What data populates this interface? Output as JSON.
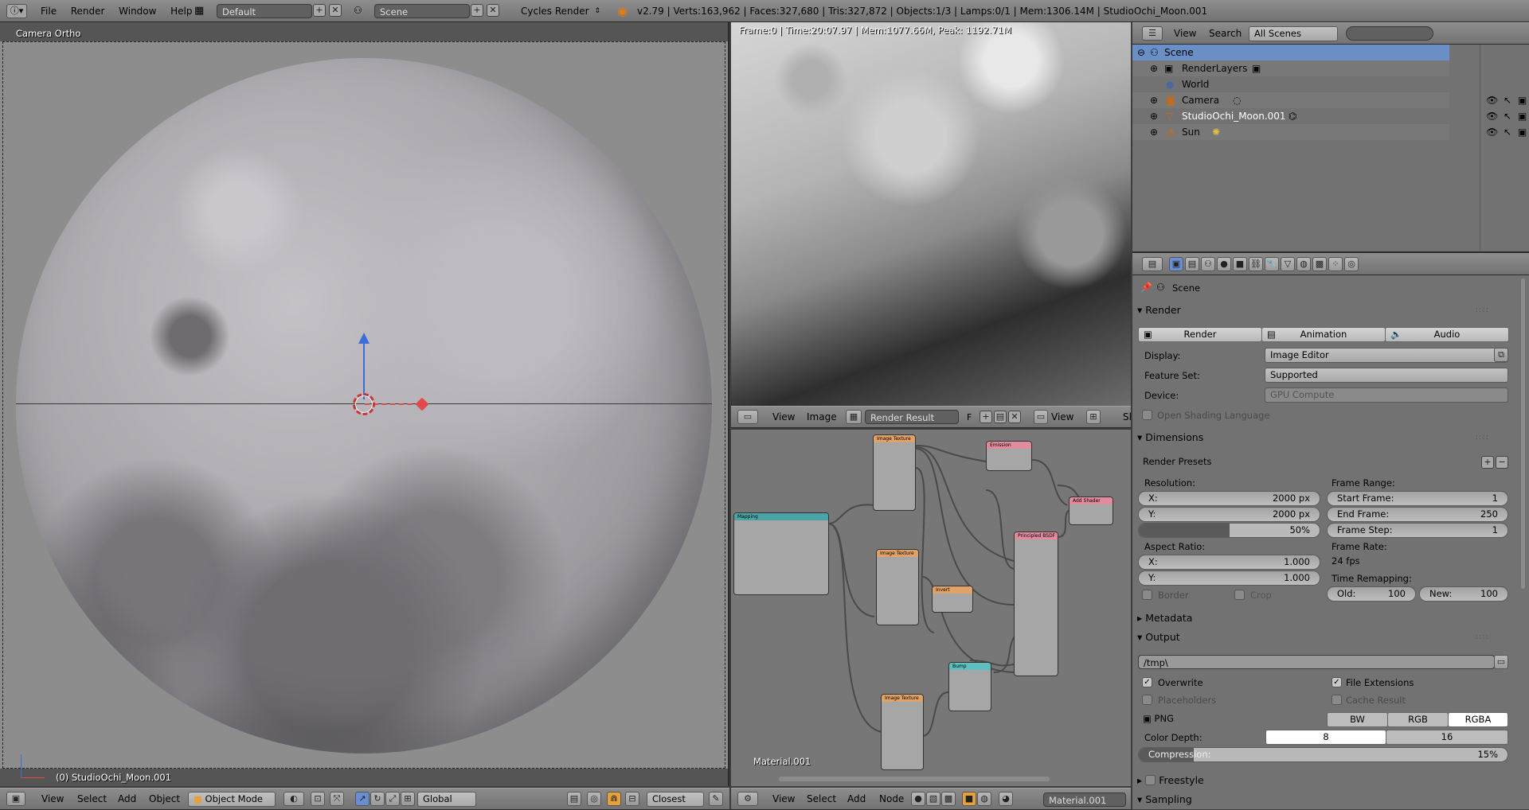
{
  "info_header": {
    "menus": [
      "File",
      "Render",
      "Window",
      "Help"
    ],
    "screen_layout": "Default",
    "scene_name": "Scene",
    "render_engine": "Cycles Render",
    "stats": "v2.79 | Verts:163,962 | Faces:327,680 | Tris:327,872 | Objects:1/3 | Lamps:0/1 | Mem:1306.14M | StudioOchi_Moon.001"
  },
  "viewport3d": {
    "view_name": "Camera Ortho",
    "object_label": "(0) StudioOchi_Moon.001",
    "header_menus": [
      "View",
      "Select",
      "Add",
      "Object"
    ],
    "mode": "Object Mode",
    "orientation": "Global",
    "snap_target": "Closest"
  },
  "render_view": {
    "info": "Frame:0 | Time:20:07.97 | Mem:1077.66M, Peak: 1192.71M",
    "header_menus": [
      "View",
      "Image"
    ],
    "image_name": "Render Result",
    "fake_user": "F",
    "view_menu": "View",
    "slot": "Sl"
  },
  "node_editor": {
    "material_label": "Material.001",
    "header_menus": [
      "View",
      "Select",
      "Add",
      "Node"
    ],
    "material_name": "Material.001",
    "nodes": [
      {
        "title": "Mapping",
        "color": "#4aa6a6"
      },
      {
        "title": "Image Texture",
        "color": "#e1a26a"
      },
      {
        "title": "Image Texture",
        "color": "#e1a26a"
      },
      {
        "title": "Image Texture",
        "color": "#e1a26a"
      },
      {
        "title": "Emission",
        "color": "#e08c9c"
      },
      {
        "title": "Add Shader",
        "color": "#e08c9c"
      },
      {
        "title": "Principled BSDF",
        "color": "#e08c9c"
      },
      {
        "title": "Invert",
        "color": "#e1a26a"
      },
      {
        "title": "Bump",
        "color": "#5fbfbf"
      }
    ]
  },
  "outliner": {
    "header_menus": [
      "View",
      "Search"
    ],
    "display_mode": "All Scenes",
    "items": [
      {
        "label": "Scene"
      },
      {
        "label": "RenderLayers"
      },
      {
        "label": "World"
      },
      {
        "label": "Camera"
      },
      {
        "label": "StudioOchi_Moon.001"
      },
      {
        "label": "Sun"
      }
    ]
  },
  "properties": {
    "context": "Scene",
    "render_panel": {
      "title": "Render",
      "buttons": [
        "Render",
        "Animation",
        "Audio"
      ],
      "display_label": "Display:",
      "display_value": "Image Editor",
      "feature_set_label": "Feature Set:",
      "feature_set_value": "Supported",
      "device_label": "Device:",
      "device_value": "GPU Compute",
      "osl_label": "Open Shading Language"
    },
    "dimensions_panel": {
      "title": "Dimensions",
      "presets": "Render Presets",
      "resolution_label": "Resolution:",
      "res_x_label": "X:",
      "res_x": "2000 px",
      "res_y_label": "Y:",
      "res_y": "2000 px",
      "res_percent": "50%",
      "res_percent_value": 0.5,
      "aspect_label": "Aspect Ratio:",
      "aspect_x_label": "X:",
      "aspect_x": "1.000",
      "aspect_y_label": "Y:",
      "aspect_y": "1.000",
      "border_label": "Border",
      "crop_label": "Crop",
      "frame_range_label": "Frame Range:",
      "start_label": "Start Frame:",
      "start": "1",
      "end_label": "End Frame:",
      "end": "250",
      "step_label": "Frame Step:",
      "step": "1",
      "frame_rate_label": "Frame Rate:",
      "frame_rate": "24 fps",
      "remap_label": "Time Remapping:",
      "old_label": "Old:",
      "old": "100",
      "new_label": "New:",
      "new": "100"
    },
    "metadata_title": "Metadata",
    "output_panel": {
      "title": "Output",
      "path": "/tmp\\",
      "overwrite": "Overwrite",
      "file_extensions": "File Extensions",
      "placeholders": "Placeholders",
      "cache_result": "Cache Result",
      "format": "PNG",
      "color_modes": [
        "BW",
        "RGB",
        "RGBA"
      ],
      "color_depth_label": "Color Depth:",
      "depths": [
        "8",
        "16"
      ],
      "compression_label": "Compression:",
      "compression": "15%",
      "compression_value": 0.15
    },
    "freestyle_title": "Freestyle",
    "sampling_title": "Sampling"
  },
  "colors": {
    "selection": "#5680c2",
    "viewport_bg": "#8c8c8c",
    "panel_bg": "#727272"
  }
}
